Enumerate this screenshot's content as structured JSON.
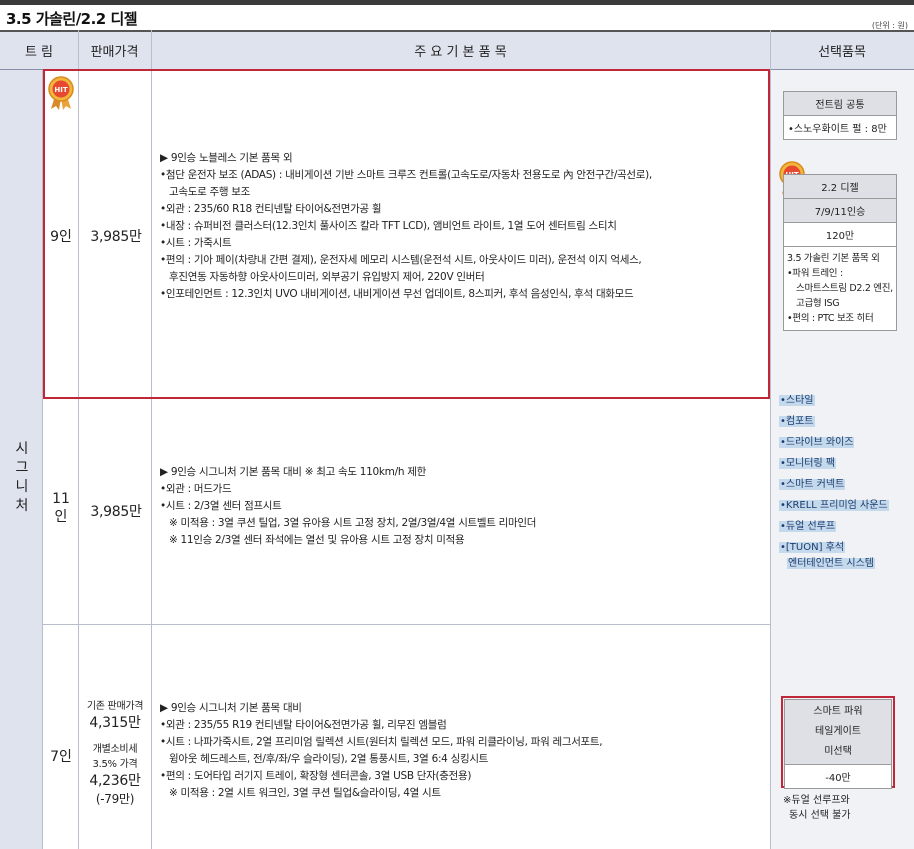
{
  "title": "3.5 가솔린/2.2 디젤",
  "unit": "(단위 : 원)",
  "headers": {
    "trim": "트 림",
    "price": "판매가격",
    "features": "주 요 기 본 품 목",
    "options": "선택품목"
  },
  "trim_name": [
    "시",
    "그",
    "니",
    "처"
  ],
  "hit_label": "HIT",
  "rows": [
    {
      "seat": "9인",
      "price": "3,985만",
      "features": [
        "▶ 9인승 노블레스 기본 품목 외",
        "•첨단 운전자 보조 (ADAS) : 내비게이션 기반 스마트 크루즈 컨트롤(고속도로/자동차 전용도로 內 안전구간/곡선로),",
        "고속도로 주행 보조",
        "•외관 : 235/60 R18 컨티넨탈 타이어&전면가공 휠",
        "•내장 : 슈퍼비전 클러스터(12.3인치 풀사이즈 칼라 TFT LCD), 앰비언트 라이트, 1열 도어 센터트림 스티치",
        "•시트 : 가죽시트",
        "•편의 : 기아 페이(차량내 간편 결제), 운전자세 메모리 시스템(운전석 시트, 아웃사이드 미러), 운전석 이지 억세스,",
        "후진연동 자동하향 아웃사이드미러, 외부공기 유입방지 제어, 220V 인버터",
        "•인포테인먼트 : 12.3인치 UVO 내비게이션, 내비게이션 무선 업데이트, 8스피커, 후석 음성인식, 후석 대화모드"
      ]
    },
    {
      "seat": "11\n인",
      "price": "3,985만",
      "features": [
        "▶ 9인승 시그니처 기본 품목 대비   ※ 최고 속도 110km/h 제한",
        "•외관 : 머드가드",
        "•시트 : 2/3열 센터 점프시트",
        "※ 미적용 : 3열 쿠션 틸업, 3열 유아용 시트 고정 장치, 2열/3열/4열 시트벨트 리마인더",
        "※ 11인승 2/3열 센터 좌석에는 열선 및 유아용 시트 고정 장치 미적용"
      ]
    },
    {
      "seat": "7인",
      "price_lines": [
        "기존 판매가격",
        "4,315만",
        "개별소비세",
        "3.5% 가격",
        "4,236만",
        "(-79만)"
      ],
      "features": [
        "▶ 9인승 시그니처 기본 품목 대비",
        "•외관 : 235/55 R19 컨티넨탈 타이어&전면가공 휠, 리무진 엠블럼",
        "•시트 : 나파가죽시트, 2열 프리미엄 릴렉션 시트(원터치 릴렉션 모드, 파워 리클라이닝, 파워 레그서포트,",
        "윙아웃 헤드레스트, 전/후/좌/우 슬라이딩), 2열 통풍시트, 3열 6:4 싱킹시트",
        "•편의 : 도어타입 러기지 트레이, 확장형 센터콘솔, 3열 USB 단자(충전용)",
        "※ 미적용 : 2열 시트 워크인, 3열 쿠션 틸업&슬라이딩, 4열 시트"
      ]
    }
  ],
  "options": {
    "common": {
      "title": "전트림 공통",
      "item": "•스노우화이트 펄  : 8만"
    },
    "diesel": {
      "title": "2.2 디젤",
      "seats": "7/9/11인승",
      "price": "120만",
      "desc": [
        "3.5 가솔린 기본 품목 외",
        "•파워 트레인 :",
        "스마트스트림 D2.2 엔진,",
        "고급형 ISG",
        "•편의 : PTC 보조 히터"
      ]
    },
    "links": [
      "•스타일",
      "•컴포트",
      "•드라이브 와이즈",
      "•모니터링 팩",
      "•스마트 커넥트",
      "•KRELL 프리미엄 사운드",
      "•듀얼 선루프",
      "•[TUON] 후석",
      "엔터테인먼트 시스템"
    ],
    "tailgate": {
      "lines": [
        "스마트 파워",
        "테일게이트",
        "미선택"
      ],
      "price": "-40만"
    },
    "note": [
      "※듀얼 선루프와",
      "동시 선택 불가"
    ]
  },
  "colors": {
    "header_bg": "#dfe3ee",
    "highlight_red": "#c0283a",
    "link_bg": "#c5d9ec"
  }
}
